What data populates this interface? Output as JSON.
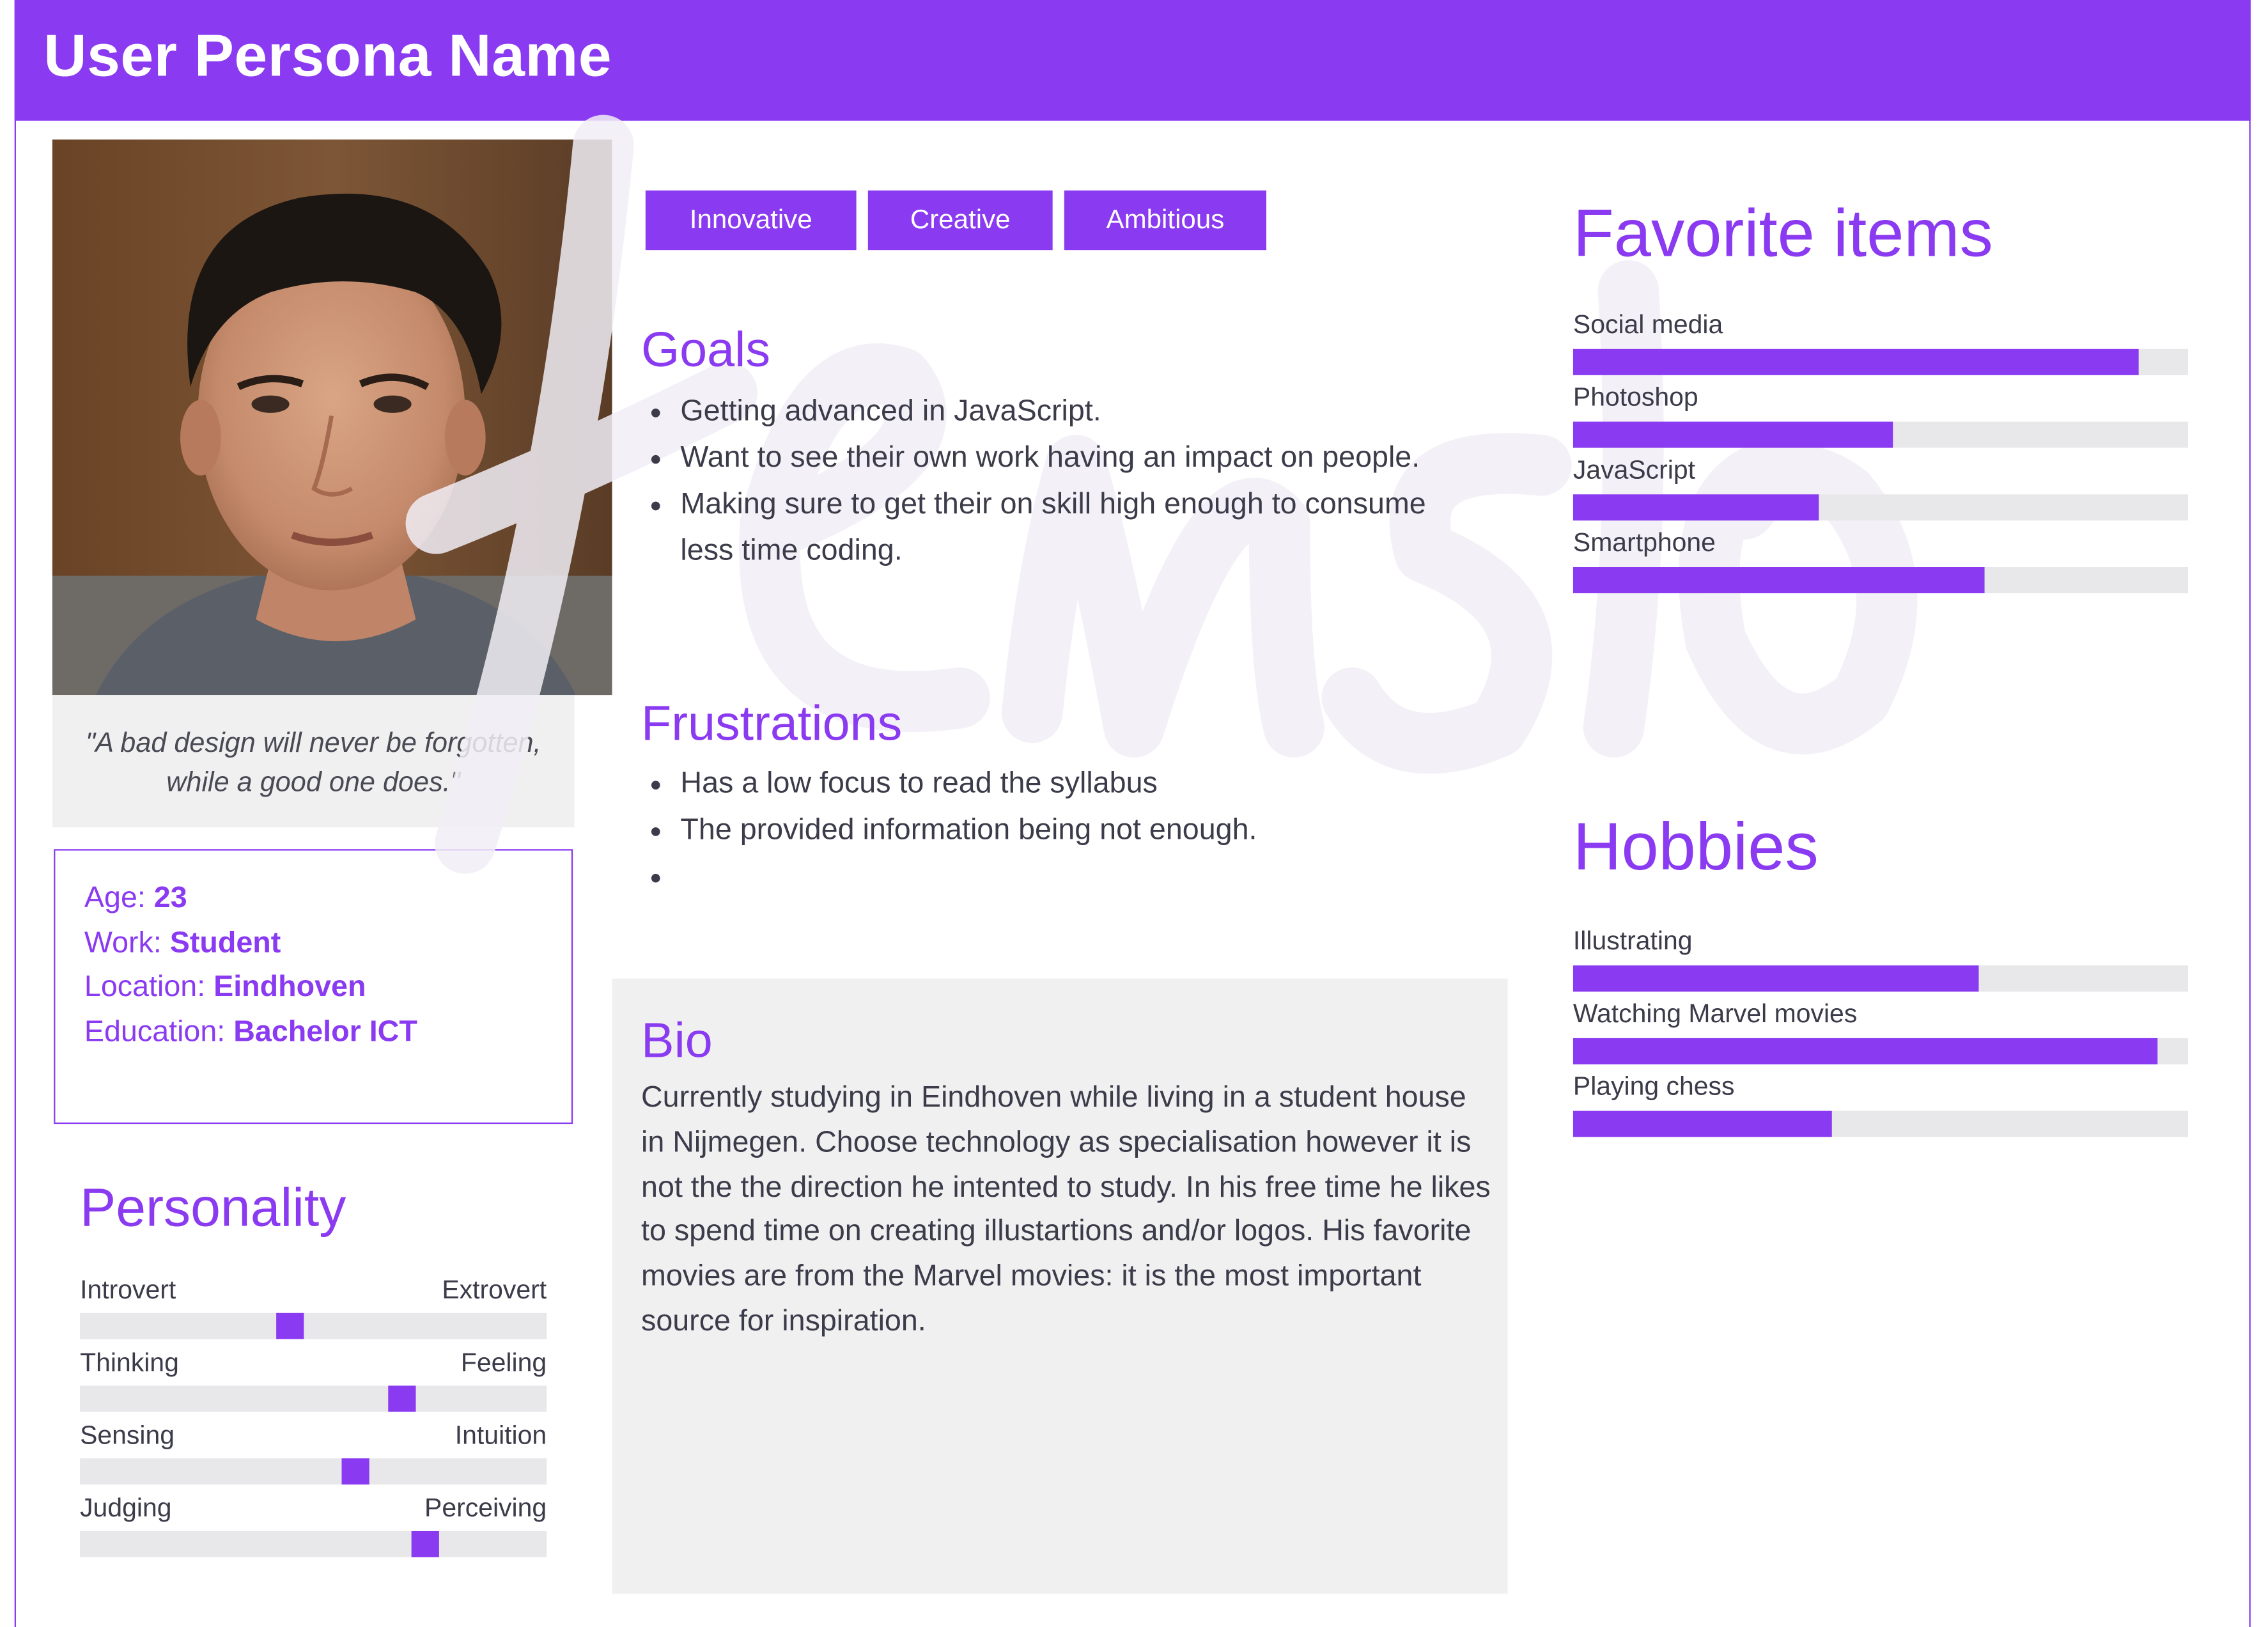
{
  "header": {
    "title": "User Persona Name"
  },
  "profile": {
    "quote": "\"A bad design will never be forgotten, while a good one does.\"",
    "info": [
      {
        "label": "Age: ",
        "value": "23"
      },
      {
        "label": "Work: ",
        "value": "Student"
      },
      {
        "label": "Location: ",
        "value": "Eindhoven"
      },
      {
        "label": "Education: ",
        "value": "Bachelor ICT"
      }
    ]
  },
  "personality": {
    "title": "Personality",
    "scales": [
      {
        "left": "Introvert",
        "right": "Extrovert",
        "value": 0.45
      },
      {
        "left": "Thinking",
        "right": "Feeling",
        "value": 0.69
      },
      {
        "left": "Sensing",
        "right": "Intuition",
        "value": 0.59
      },
      {
        "left": "Judging",
        "right": "Perceiving",
        "value": 0.74
      }
    ]
  },
  "tags": [
    "Innovative",
    "Creative",
    "Ambitious"
  ],
  "goals": {
    "title": "Goals",
    "items": [
      "Getting advanced in JavaScript.",
      "Want to see their own work having an impact on people.",
      "Making sure to get their on skill high enough to consume less time coding."
    ]
  },
  "frustrations": {
    "title": "Frustrations",
    "items": [
      "Has a low focus to read the syllabus",
      "The provided information being not enough.",
      ""
    ]
  },
  "bio": {
    "title": "Bio",
    "text": "Currently studying in Eindhoven while living in a student house in Nijmegen. Choose technology as specialisation however it is not the the direction he intented to study. In his free time he likes to spend time on creating illustartions and/or logos. His favorite movies are from the Marvel movies: it is the most important source for inspiration."
  },
  "favorites": {
    "title": "Favorite items",
    "items": [
      {
        "label": "Social media",
        "value": 0.92
      },
      {
        "label": "Photoshop",
        "value": 0.52
      },
      {
        "label": "JavaScript",
        "value": 0.4
      },
      {
        "label": "Smartphone",
        "value": 0.67
      }
    ]
  },
  "hobbies": {
    "title": "Hobbies",
    "items": [
      {
        "label": "Illustrating",
        "value": 0.66
      },
      {
        "label": "Watching Marvel movies",
        "value": 0.95
      },
      {
        "label": "Playing chess",
        "value": 0.42
      }
    ]
  },
  "colors": {
    "accent": "#8a3af0",
    "panel": "#f0f0f1",
    "track": "#e8e8ea",
    "text": "#3b3b4a"
  },
  "icons": {
    "photo": "portrait-photo",
    "watermark": "xtensio-watermark-logo"
  }
}
